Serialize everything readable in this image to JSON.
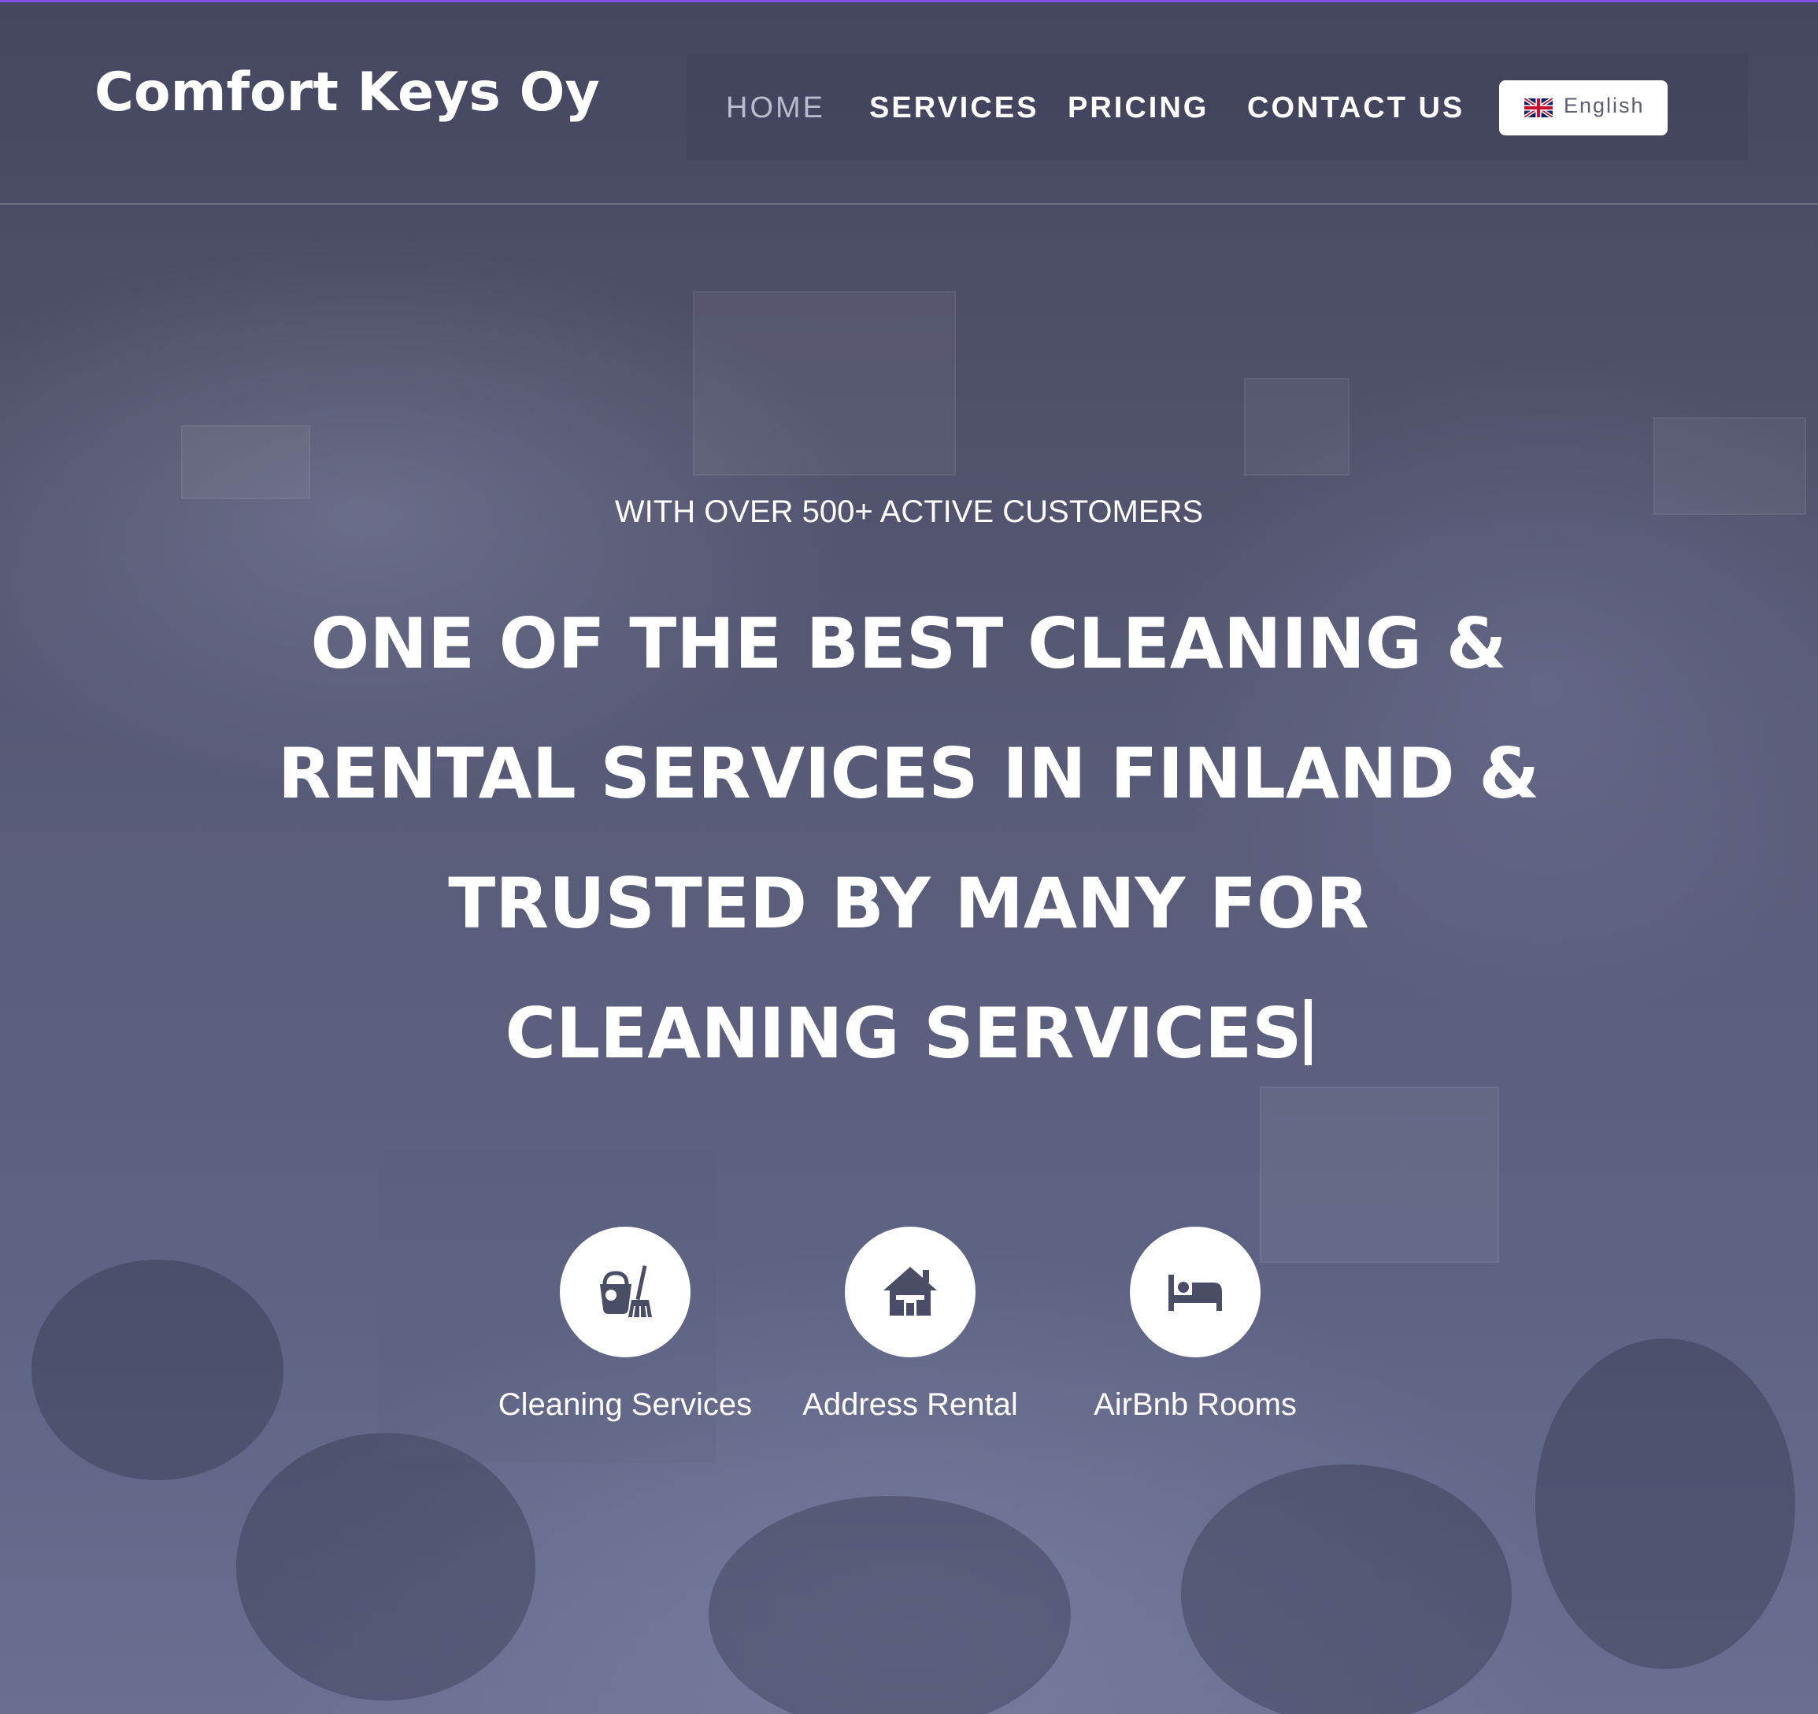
{
  "brand": {
    "name": "Comfort Keys Oy"
  },
  "nav": {
    "items": [
      {
        "label": "HOME",
        "active": true
      },
      {
        "label": "SERVICES",
        "active": false
      },
      {
        "label": "PRICING",
        "active": false
      },
      {
        "label": "CONTACT US",
        "active": false
      }
    ],
    "language": {
      "label": "English",
      "flag_icon": "uk-flag-icon"
    }
  },
  "hero": {
    "subtitle": "WITH OVER 500+ ACTIVE CUSTOMERS",
    "title_lines": [
      "ONE OF THE BEST CLEANING &",
      "RENTAL SERVICES IN FINLAND &",
      "TRUSTED BY MANY FOR",
      "CLEANING SERVICES"
    ]
  },
  "services": [
    {
      "label": "Cleaning Services",
      "icon": "cleaning-bucket-icon"
    },
    {
      "label": "Address Rental",
      "icon": "house-icon"
    },
    {
      "label": "AirBnb Rooms",
      "icon": "bed-icon"
    }
  ],
  "colors": {
    "accent": "#7b4fe0",
    "icon": "#4a4d66",
    "text": "#ffffff"
  }
}
